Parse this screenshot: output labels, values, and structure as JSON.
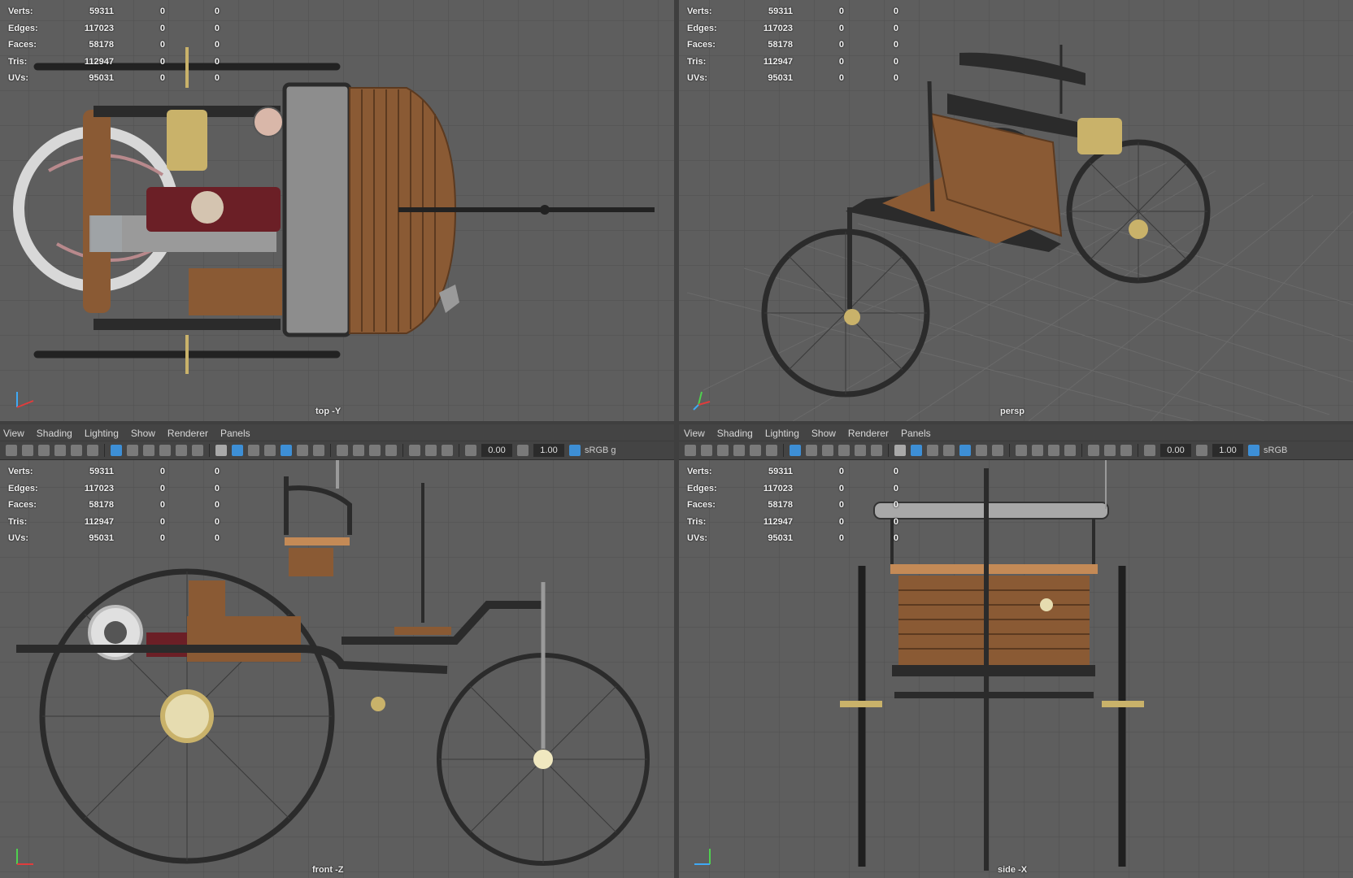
{
  "stats": {
    "rows": [
      {
        "label": "Verts:",
        "value": "59311",
        "z1": "0",
        "z2": "0"
      },
      {
        "label": "Edges:",
        "value": "117023",
        "z1": "0",
        "z2": "0"
      },
      {
        "label": "Faces:",
        "value": "58178",
        "z1": "0",
        "z2": "0"
      },
      {
        "label": "Tris:",
        "value": "112947",
        "z1": "0",
        "z2": "0"
      },
      {
        "label": "UVs:",
        "value": "95031",
        "z1": "0",
        "z2": "0"
      }
    ]
  },
  "viewports": {
    "top": {
      "camera": "top -Y"
    },
    "persp": {
      "camera": "persp"
    },
    "front": {
      "camera": "front -Z"
    },
    "side": {
      "camera": "side -X"
    }
  },
  "menu": [
    "View",
    "Shading",
    "Lighting",
    "Show",
    "Renderer",
    "Panels"
  ],
  "toolbar": {
    "exposure": "0.00",
    "gamma": "1.00",
    "colorspace_left": "sRGB g",
    "colorspace_right": "sRGB"
  },
  "colors": {
    "viewport_bg": "#5e5e5e",
    "grid": "#4f4f4f",
    "wood": "#8a5a34",
    "metal_dark": "#2b2b2b",
    "brass": "#c9b26a",
    "burgundy": "#6b1f26",
    "accent_blue": "#3d8fd6"
  }
}
